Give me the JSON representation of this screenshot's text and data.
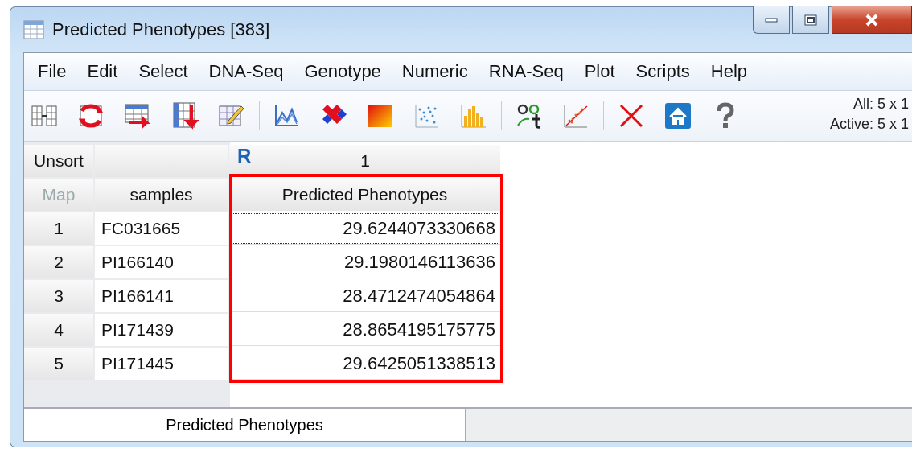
{
  "window": {
    "title": "Predicted Phenotypes [383]"
  },
  "menu": [
    "File",
    "Edit",
    "Select",
    "DNA-Seq",
    "Genotype",
    "Numeric",
    "RNA-Seq",
    "Plot",
    "Scripts",
    "Help"
  ],
  "toolbar_info": {
    "all": "All: 5 x 1",
    "active": "Active: 5 x 1"
  },
  "table": {
    "corner_top": "Unsort",
    "corner_bottom": "Map",
    "row_label_header": "samples",
    "column_type": "R",
    "column_number": "1",
    "columns": [
      {
        "label": "Predicted Phenotypes",
        "highlighted": true
      }
    ],
    "rows": [
      {
        "index": "1",
        "sample": "FC031665",
        "value": "29.6244073330668",
        "focused": true
      },
      {
        "index": "2",
        "sample": "PI166140",
        "value": "29.1980146113636",
        "focused": false
      },
      {
        "index": "3",
        "sample": "PI166141",
        "value": "28.4712474054864",
        "focused": false
      },
      {
        "index": "4",
        "sample": "PI171439",
        "value": "28.8654195175775",
        "focused": false
      },
      {
        "index": "5",
        "sample": "PI171445",
        "value": "29.6425051338513",
        "focused": false
      }
    ]
  },
  "sheet_tabs": [
    {
      "label": "Predicted Phenotypes",
      "selected": true
    }
  ]
}
